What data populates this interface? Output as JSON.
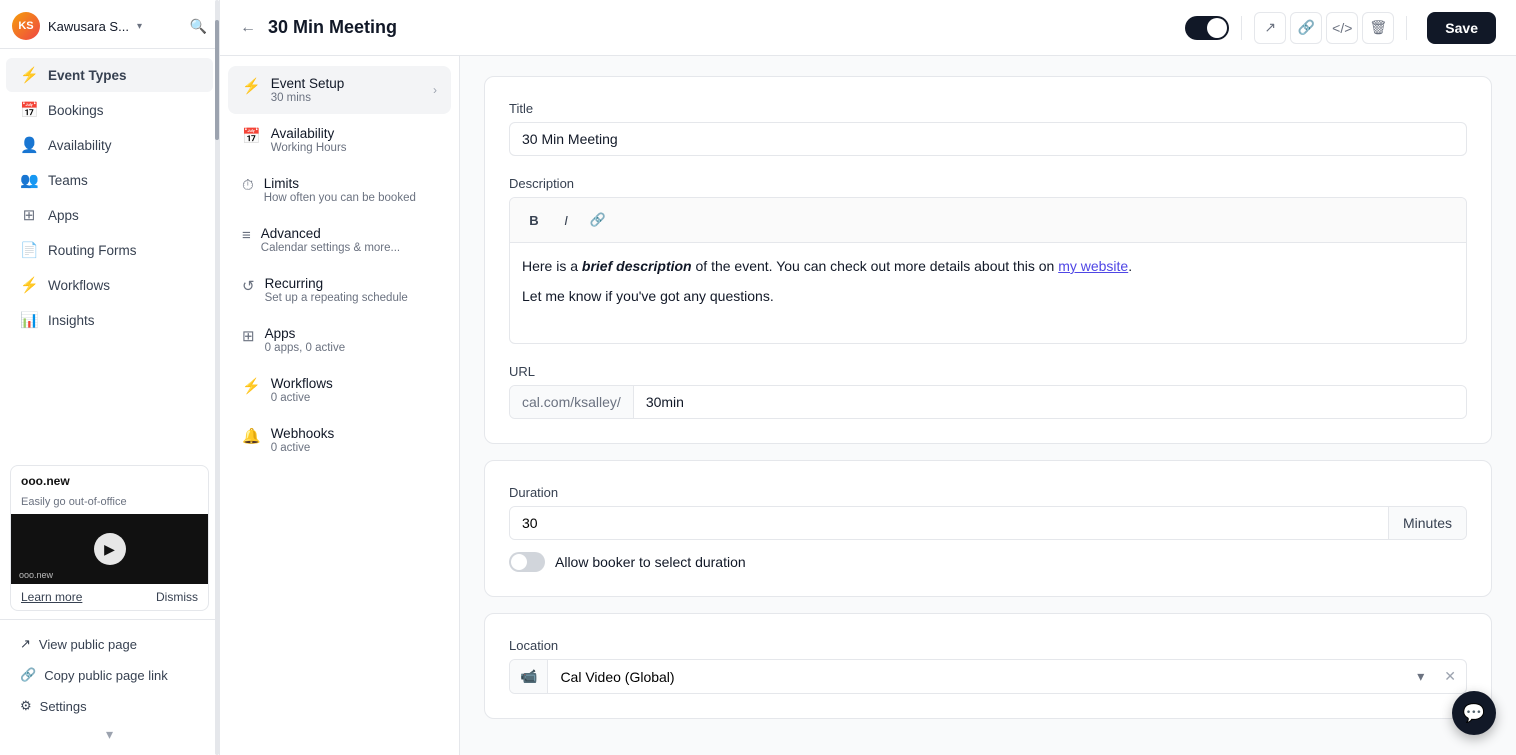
{
  "user": {
    "name": "Kawusara S...",
    "initials": "KS"
  },
  "sidebar": {
    "nav_items": [
      {
        "id": "event-types",
        "label": "Event Types",
        "icon": "⚡",
        "active": true
      },
      {
        "id": "bookings",
        "label": "Bookings",
        "icon": "📅"
      },
      {
        "id": "availability",
        "label": "Availability",
        "icon": "👤"
      },
      {
        "id": "teams",
        "label": "Teams",
        "icon": "👥"
      },
      {
        "id": "apps",
        "label": "Apps",
        "icon": "⊞"
      },
      {
        "id": "routing-forms",
        "label": "Routing Forms",
        "icon": "📄"
      },
      {
        "id": "workflows",
        "label": "Workflows",
        "icon": "⚡"
      },
      {
        "id": "insights",
        "label": "Insights",
        "icon": "📊"
      }
    ],
    "promo": {
      "title": "ooo.new",
      "subtitle": "Easily go out-of-office",
      "video_label": "ooo.new",
      "learn_more": "Learn more",
      "dismiss": "Dismiss"
    },
    "bottom_items": [
      {
        "id": "view-public-page",
        "label": "View public page",
        "icon": "↗"
      },
      {
        "id": "copy-public-link",
        "label": "Copy public page link",
        "icon": "🔗"
      },
      {
        "id": "settings",
        "label": "Settings",
        "icon": "⚙"
      }
    ]
  },
  "topbar": {
    "title": "30 Min Meeting",
    "save_label": "Save"
  },
  "mid_nav": {
    "items": [
      {
        "id": "event-setup",
        "label": "Event Setup",
        "sub": "30 mins",
        "icon": "⚡",
        "active": true,
        "has_chevron": true
      },
      {
        "id": "availability",
        "label": "Availability",
        "sub": "Working Hours",
        "icon": "📅",
        "has_chevron": false
      },
      {
        "id": "limits",
        "label": "Limits",
        "sub": "How often you can be booked",
        "icon": "⏱",
        "has_chevron": false
      },
      {
        "id": "advanced",
        "label": "Advanced",
        "sub": "Calendar settings & more...",
        "icon": "≡",
        "has_chevron": false
      },
      {
        "id": "recurring",
        "label": "Recurring",
        "sub": "Set up a repeating schedule",
        "icon": "↺",
        "has_chevron": false
      },
      {
        "id": "apps",
        "label": "Apps",
        "sub": "0 apps, 0 active",
        "icon": "⊞",
        "has_chevron": false
      },
      {
        "id": "workflows",
        "label": "Workflows",
        "sub": "0 active",
        "icon": "⚡",
        "has_chevron": false
      },
      {
        "id": "webhooks",
        "label": "Webhooks",
        "sub": "0 active",
        "icon": "🔔",
        "has_chevron": false
      }
    ]
  },
  "form": {
    "title_label": "Title",
    "title_value": "30 Min Meeting",
    "description_label": "Description",
    "description_line1_plain": "Here is a ",
    "description_line1_bold_italic": "brief description",
    "description_line1_mid": " of the event. You can check out more details about this on ",
    "description_line1_link": "my website",
    "description_line1_end": ".",
    "description_line2": "Let me know if you’ve got any questions.",
    "url_label": "URL",
    "url_prefix": "cal.com/ksalley/",
    "url_value": "30min",
    "duration_label": "Duration",
    "duration_value": "30",
    "duration_unit": "Minutes",
    "allow_select_label": "Allow booker to select duration",
    "location_label": "Location",
    "location_value": "Cal Video (Global)"
  },
  "colors": {
    "accent": "#111827",
    "brand": "#4f46e5"
  }
}
